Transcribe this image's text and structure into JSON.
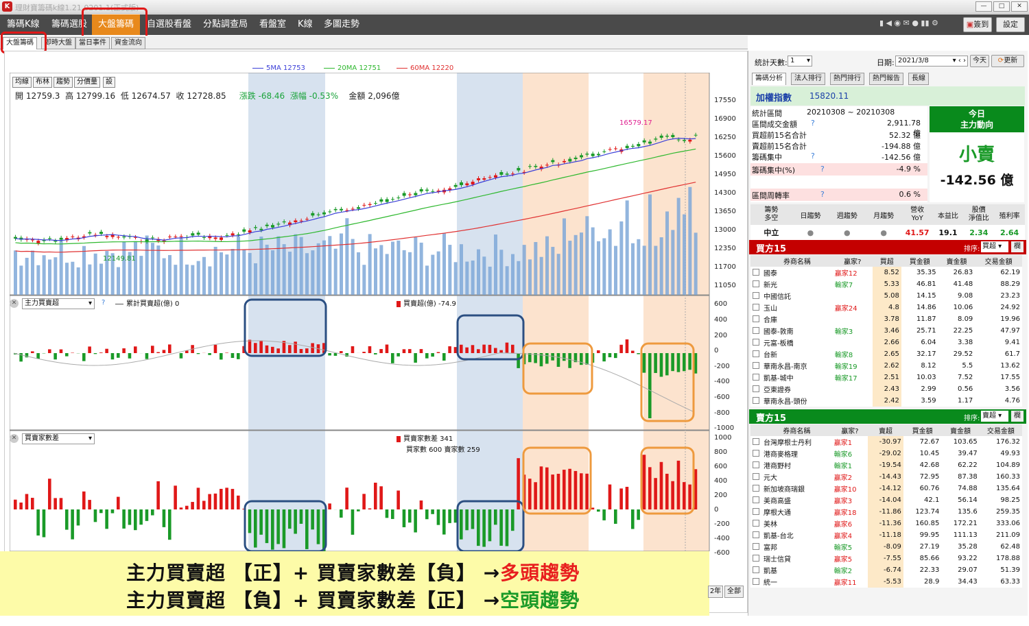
{
  "window": {
    "title": "理財寶籌碼k線1.21.0201.1(正式版)",
    "logo": "K",
    "min": "—",
    "max": "□",
    "close": "✕"
  },
  "menu": {
    "items": [
      "籌碼K線",
      "籌碼選股",
      "大盤籌碼",
      "自選股看盤",
      "分點調查局",
      "看盤室",
      "K線",
      "多圖走勢"
    ],
    "active": "大盤籌碼",
    "icons": "▮ ◀ ◉ ✉ ● ▮▮ ⚙",
    "checkin": "簽到",
    "settings": "設定"
  },
  "subtabs": [
    "大盤籌碼",
    "即時大盤",
    "當日事件",
    "資金流向"
  ],
  "ma_legend": [
    {
      "label": "5MA 12753",
      "color": "#3b3fd8"
    },
    {
      "label": "20MA 12751",
      "color": "#2eb82e"
    },
    {
      "label": "60MA 12220",
      "color": "#e03030"
    }
  ],
  "price_tabs": [
    "均線",
    "布林",
    "趨勢",
    "分價量",
    "設"
  ],
  "ohlc": {
    "open": "開 12759.3",
    "high": "高 12799.16",
    "low": "低 12674.57",
    "close": "收 12728.85",
    "chg": "漲跌 -68.46",
    "pct": "漲幅 -0.53%",
    "amount": "金額 2,096億"
  },
  "price_axis": [
    "17550",
    "16900",
    "16250",
    "15600",
    "14950",
    "14300",
    "13650",
    "13000",
    "12350",
    "11700",
    "11050"
  ],
  "price_annotations": {
    "high": "16579.17",
    "low": "12149.81"
  },
  "panel2": {
    "select": "主力買賣超",
    "help": "?",
    "cum_label": "累計買賣超(億) 0",
    "bs_label": "買賣超(億) -74.9",
    "axis": [
      "600",
      "400",
      "200",
      "0",
      "-200",
      "-400",
      "-600",
      "-800",
      "-1000"
    ]
  },
  "panel3": {
    "select": "買賣家數差",
    "diff_label": "買賣家數差 341",
    "counts_label": "買家數 600 賣家數 259",
    "axis": [
      "1000",
      "800",
      "600",
      "400",
      "200",
      "0",
      "-200",
      "-400",
      "-600"
    ]
  },
  "banner": {
    "line1_prefix": "主力買賣超 【正】+ 買賣家數差【負】 →",
    "line1_result": "多頭趨勢",
    "line2_prefix": "主力買賣超 【負】+ 買賣家數差【正】 →",
    "line2_result": "空頭趨勢"
  },
  "bottom_buttons": [
    "2年",
    "全部"
  ],
  "right": {
    "days_label": "統計天數:",
    "days_value": "1",
    "date_label": "日期:",
    "date_value": "2021/3/8",
    "today_btn": "今天",
    "refresh_btn": "更新",
    "tabs": [
      "籌碼分析",
      "法人排行",
      "熱門排行",
      "熱門報告",
      "長線"
    ],
    "index_name": "加權指數",
    "index_value": "15820.11",
    "stats": [
      {
        "label": "統計區間",
        "value": "20210308 ~ 20210308"
      },
      {
        "label": "區間成交金額",
        "q": "?",
        "value": "2,911.78 億"
      },
      {
        "label": "買超前15名合計",
        "value": "52.32 億"
      },
      {
        "label": "賣超前15名合計",
        "value": "-194.88 億"
      },
      {
        "label": "籌碼集中",
        "q": "?",
        "value": "-142.56 億"
      },
      {
        "label": "籌碼集中(%)",
        "q": "?",
        "value": "-4.9 %"
      },
      {
        "label": "區間周轉率",
        "q": "?",
        "value": "0.6 %"
      }
    ],
    "today_box": {
      "title1": "今日",
      "title2": "主力動向",
      "verdict": "小賣",
      "amount": "-142.56 億"
    },
    "trend_headers": [
      "籌勢\n多空",
      "日趨勢",
      "週趨勢",
      "月趨勢",
      "營收\nYoY",
      "本益比",
      "股價\n淨值比",
      "殖利率"
    ],
    "trend_values": {
      "state": "中立",
      "yoy": "41.57",
      "pe": "19.1",
      "pb": "2.34",
      "yield": "2.64"
    },
    "buy15": {
      "title": "買方15",
      "sort_label": "排序:",
      "sort_value": "買超",
      "col_btn": "欄",
      "headers": [
        "券商名稱",
        "贏家?",
        "買超",
        "買金額",
        "賣金額",
        "交易金額"
      ],
      "rows": [
        [
          "國泰",
          "贏家12",
          "8.52",
          "35.35",
          "26.83",
          "62.19"
        ],
        [
          "新光",
          "輸家7",
          "5.33",
          "46.81",
          "41.48",
          "88.29"
        ],
        [
          "中國信託",
          "",
          "5.08",
          "14.15",
          "9.08",
          "23.23"
        ],
        [
          "玉山",
          "贏家24",
          "4.8",
          "14.86",
          "10.06",
          "24.92"
        ],
        [
          "合庫",
          "",
          "3.78",
          "11.87",
          "8.09",
          "19.96"
        ],
        [
          "國泰-敦南",
          "輸家3",
          "3.46",
          "25.71",
          "22.25",
          "47.97"
        ],
        [
          "元富-板橋",
          "",
          "2.66",
          "6.04",
          "3.38",
          "9.41"
        ],
        [
          "台新",
          "輸家8",
          "2.65",
          "32.17",
          "29.52",
          "61.7"
        ],
        [
          "華南永昌-南京",
          "輸家19",
          "2.62",
          "8.12",
          "5.5",
          "13.62"
        ],
        [
          "凱基-城中",
          "輸家17",
          "2.51",
          "10.03",
          "7.52",
          "17.55"
        ],
        [
          "亞東證券",
          "",
          "2.43",
          "2.99",
          "0.56",
          "3.56"
        ],
        [
          "華南永昌-頭份",
          "",
          "2.42",
          "3.59",
          "1.17",
          "4.76"
        ]
      ]
    },
    "sell15": {
      "title": "賣方15",
      "sort_label": "排序:",
      "sort_value": "賣超",
      "col_btn": "欄",
      "headers": [
        "券商名稱",
        "贏家?",
        "賣超",
        "買金額",
        "賣金額",
        "交易金額"
      ],
      "rows": [
        [
          "台灣摩根士丹利",
          "贏家1",
          "-30.97",
          "72.67",
          "103.65",
          "176.32"
        ],
        [
          "港商麥格理",
          "輸家6",
          "-29.02",
          "10.45",
          "39.47",
          "49.93"
        ],
        [
          "港商野村",
          "輸家1",
          "-19.54",
          "42.68",
          "62.22",
          "104.89"
        ],
        [
          "元大",
          "贏家2",
          "-14.43",
          "72.95",
          "87.38",
          "160.33"
        ],
        [
          "新加坡商瑞銀",
          "贏家10",
          "-14.12",
          "60.76",
          "74.88",
          "135.64"
        ],
        [
          "美商高盛",
          "贏家3",
          "-14.04",
          "42.1",
          "56.14",
          "98.25"
        ],
        [
          "摩根大通",
          "贏家18",
          "-11.86",
          "123.74",
          "135.6",
          "259.35"
        ],
        [
          "美林",
          "贏家6",
          "-11.36",
          "160.85",
          "172.21",
          "333.06"
        ],
        [
          "凱基-台北",
          "贏家4",
          "-11.18",
          "99.95",
          "111.13",
          "211.09"
        ],
        [
          "富邦",
          "輸家5",
          "-8.09",
          "27.19",
          "35.28",
          "62.48"
        ],
        [
          "瑞士信貸",
          "贏家5",
          "-7.55",
          "85.66",
          "93.22",
          "178.88"
        ],
        [
          "凱基",
          "輸家2",
          "-6.74",
          "22.33",
          "29.07",
          "51.39"
        ],
        [
          "統一",
          "贏家11",
          "-5.53",
          "28.9",
          "34.43",
          "63.33"
        ]
      ]
    }
  }
}
